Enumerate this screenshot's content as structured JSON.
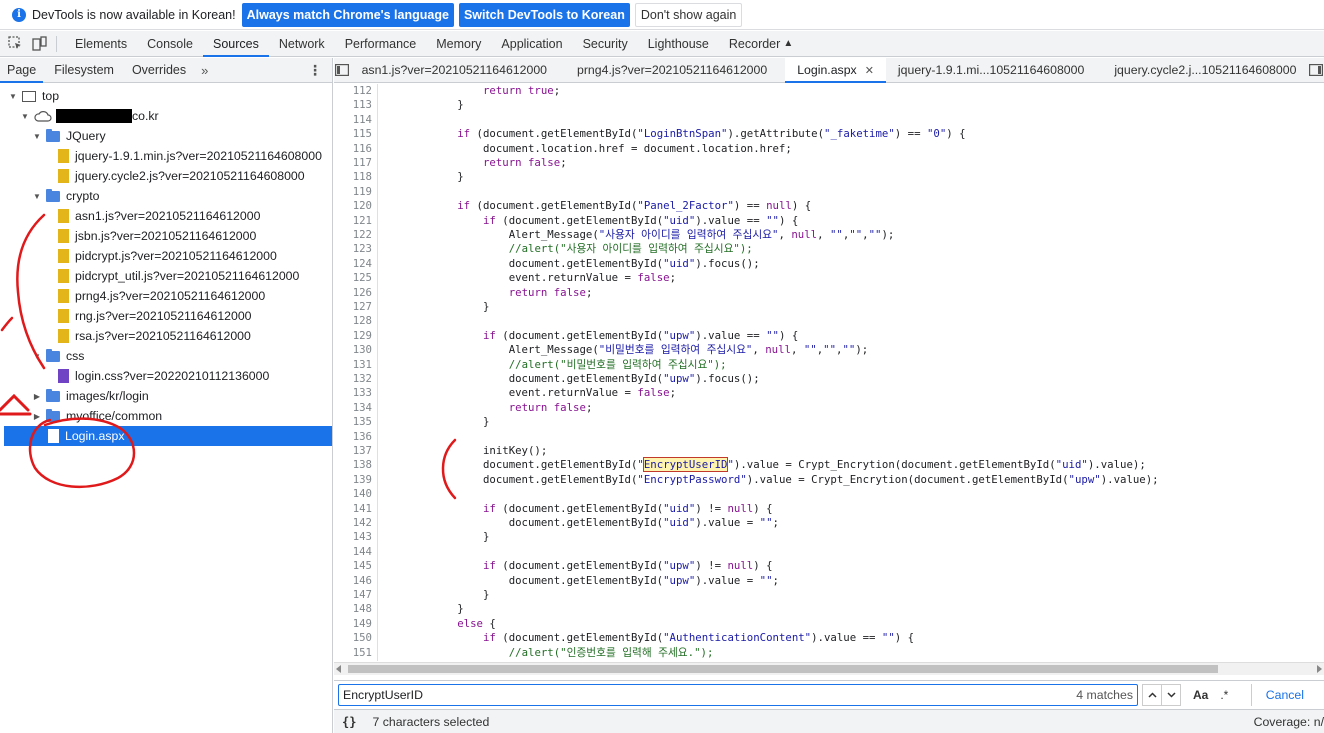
{
  "infobar": {
    "message": "DevTools is now available in Korean!",
    "btn_match": "Always match Chrome's language",
    "btn_switch": "Switch DevTools to Korean",
    "btn_dismiss": "Don't show again"
  },
  "main_tabs": [
    "Elements",
    "Console",
    "Sources",
    "Network",
    "Performance",
    "Memory",
    "Application",
    "Security",
    "Lighthouse",
    "Recorder"
  ],
  "left_tabs": [
    "Page",
    "Filesystem",
    "Overrides"
  ],
  "tree": {
    "top": "top",
    "domain_suffix": "co.kr",
    "folders": {
      "jquery": "JQuery",
      "crypto": "crypto",
      "css": "css",
      "images": "images/kr/login",
      "myoffice": "myoffice/common"
    },
    "jquery_files": [
      "jquery-1.9.1.min.js?ver=20210521164608000",
      "jquery.cycle2.js?ver=20210521164608000"
    ],
    "crypto_files": [
      "asn1.js?ver=20210521164612000",
      "jsbn.js?ver=20210521164612000",
      "pidcrypt.js?ver=20210521164612000",
      "pidcrypt_util.js?ver=20210521164612000",
      "prng4.js?ver=20210521164612000",
      "rng.js?ver=20210521164612000",
      "rsa.js?ver=20210521164612000"
    ],
    "css_files": [
      "login.css?ver=20220210112136000"
    ],
    "selected_file": "Login.aspx"
  },
  "editor_tabs": [
    {
      "label": "asn1.js?ver=20210521164612000"
    },
    {
      "label": "prng4.js?ver=20210521164612000"
    },
    {
      "label": "Login.aspx",
      "active": true
    },
    {
      "label": "jquery-1.9.1.mi...10521164608000"
    },
    {
      "label": "jquery.cycle2.j...10521164608000"
    }
  ],
  "code_lines": [
    [
      112,
      "                return true;"
    ],
    [
      113,
      "            }"
    ],
    [
      114,
      ""
    ],
    [
      115,
      "            if (document.getElementById(\"LoginBtnSpan\").getAttribute(\"_faketime\") == \"0\") {"
    ],
    [
      116,
      "                document.location.href = document.location.href;"
    ],
    [
      117,
      "                return false;"
    ],
    [
      118,
      "            }"
    ],
    [
      119,
      ""
    ],
    [
      120,
      "            if (document.getElementById(\"Panel_2Factor\") == null) {"
    ],
    [
      121,
      "                if (document.getElementById(\"uid\").value == \"\") {"
    ],
    [
      122,
      "                    Alert_Message(\"사용자 아이디를 입력하여 주십시요\", null, \"\",\"\",\"\");"
    ],
    [
      123,
      "                    //alert(\"사용자 아이디를 입력하여 주십시요\");"
    ],
    [
      124,
      "                    document.getElementById(\"uid\").focus();"
    ],
    [
      125,
      "                    event.returnValue = false;"
    ],
    [
      126,
      "                    return false;"
    ],
    [
      127,
      "                }"
    ],
    [
      128,
      ""
    ],
    [
      129,
      "                if (document.getElementById(\"upw\").value == \"\") {"
    ],
    [
      130,
      "                    Alert_Message(\"비밀번호를 입력하여 주십시요\", null, \"\",\"\",\"\");"
    ],
    [
      131,
      "                    //alert(\"비밀번호를 입력하여 주십시요\");"
    ],
    [
      132,
      "                    document.getElementById(\"upw\").focus();"
    ],
    [
      133,
      "                    event.returnValue = false;"
    ],
    [
      134,
      "                    return false;"
    ],
    [
      135,
      "                }"
    ],
    [
      136,
      ""
    ],
    [
      137,
      "                initKey();"
    ],
    [
      138,
      "                document.getElementById(\"EncryptUserID\").value = Crypt_Encrytion(document.getElementById(\"uid\").value);"
    ],
    [
      139,
      "                document.getElementById(\"EncryptPassword\").value = Crypt_Encrytion(document.getElementById(\"upw\").value);"
    ],
    [
      140,
      ""
    ],
    [
      141,
      "                if (document.getElementById(\"uid\") != null) {"
    ],
    [
      142,
      "                    document.getElementById(\"uid\").value = \"\";"
    ],
    [
      143,
      "                }"
    ],
    [
      144,
      ""
    ],
    [
      145,
      "                if (document.getElementById(\"upw\") != null) {"
    ],
    [
      146,
      "                    document.getElementById(\"upw\").value = \"\";"
    ],
    [
      147,
      "                }"
    ],
    [
      148,
      "            }"
    ],
    [
      149,
      "            else {"
    ],
    [
      150,
      "                if (document.getElementById(\"AuthenticationContent\").value == \"\") {"
    ],
    [
      151,
      "                    //alert(\"인증번호를 입력해 주세요.\");"
    ]
  ],
  "search": {
    "query": "EncryptUserID",
    "count": "4 matches",
    "case_label": "Aa",
    "regex_label": ".*",
    "cancel_label": "Cancel"
  },
  "status": {
    "selection": "7 characters selected",
    "coverage": "Coverage: n/"
  },
  "colors": {
    "accent": "#1a73e8",
    "annotation": "#e0191b"
  }
}
